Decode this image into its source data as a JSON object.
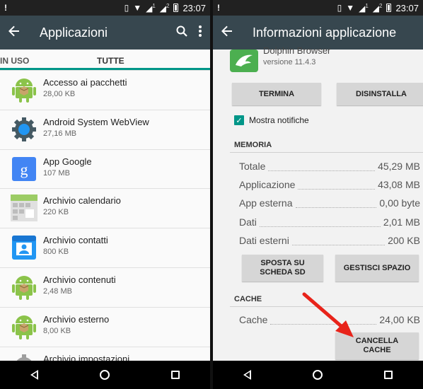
{
  "status_bar": {
    "warning": "!",
    "sim1": "1",
    "sim2": "2",
    "time": "23:07"
  },
  "left": {
    "toolbar": {
      "title": "Applicazioni",
      "back_icon": "arrow-back-icon",
      "search_icon": "search-icon",
      "menu_icon": "more-vert-icon"
    },
    "tabs": {
      "in_uso": "IN USO",
      "tutte": "TUTTE"
    },
    "apps": [
      {
        "name": "Accesso ai pacchetti",
        "size": "28,00 KB",
        "icon": "android-robot-icon"
      },
      {
        "name": "Android System WebView",
        "size": "27,16 MB",
        "icon": "gear-icon"
      },
      {
        "name": "App Google",
        "size": "107 MB",
        "icon": "google-g-icon"
      },
      {
        "name": "Archivio calendario",
        "size": "220 KB",
        "icon": "calendar-grid-icon"
      },
      {
        "name": "Archivio contatti",
        "size": "800 KB",
        "icon": "contact-card-icon"
      },
      {
        "name": "Archivio contenuti",
        "size": "2,48 MB",
        "icon": "android-robot-icon"
      },
      {
        "name": "Archivio esterno",
        "size": "8,00 KB",
        "icon": "android-robot-icon"
      },
      {
        "name": "Archivio impostazioni",
        "size": "",
        "icon": "gear-icon"
      }
    ]
  },
  "right": {
    "toolbar": {
      "title": "Informazioni applicazione",
      "back_icon": "arrow-back-icon"
    },
    "app": {
      "name": "Dolphin Browser",
      "version": "versione 11.4.3",
      "icon": "dolphin-icon"
    },
    "buttons": {
      "termina": "TERMINA",
      "disinstalla": "DISINSTALLA"
    },
    "notifications": {
      "label": "Mostra notifiche",
      "checked": true
    },
    "memoria": {
      "header": "MEMORIA",
      "rows": [
        {
          "label": "Totale",
          "value": "45,29 MB"
        },
        {
          "label": "Applicazione",
          "value": "43,08 MB"
        },
        {
          "label": "App esterna",
          "value": "0,00 byte"
        },
        {
          "label": "Dati",
          "value": "2,01 MB"
        },
        {
          "label": "Dati esterni",
          "value": "200 KB"
        }
      ],
      "sposta_line1": "SPOSTA SU",
      "sposta_line2": "SCHEDA SD",
      "gestisci": "GESTISCI SPAZIO"
    },
    "cache": {
      "header": "CACHE",
      "label": "Cache",
      "value": "24,00 KB",
      "button_line1": "CANCELLA",
      "button_line2": "CACHE"
    },
    "annotation_color": "#e8231a"
  },
  "colors": {
    "toolbar": "#37474f",
    "accent": "#009688",
    "statusbar": "#212121"
  }
}
